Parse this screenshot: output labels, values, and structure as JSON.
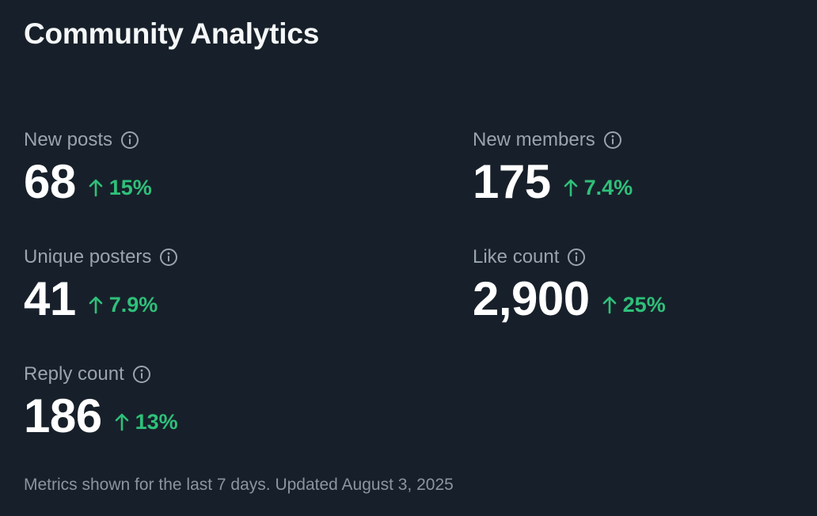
{
  "header": {
    "title": "Community Analytics"
  },
  "metrics": {
    "new_posts": {
      "label": "New posts",
      "value": "68",
      "change": "15%",
      "direction": "up"
    },
    "new_members": {
      "label": "New members",
      "value": "175",
      "change": "7.4%",
      "direction": "up"
    },
    "unique_posters": {
      "label": "Unique posters",
      "value": "41",
      "change": "7.9%",
      "direction": "up"
    },
    "like_count": {
      "label": "Like count",
      "value": "2,900",
      "change": "25%",
      "direction": "up"
    },
    "reply_count": {
      "label": "Reply count",
      "value": "186",
      "change": "13%",
      "direction": "up"
    }
  },
  "footer": {
    "note": "Metrics shown for the last 7 days. Updated August 3, 2025"
  },
  "icons": {
    "info": "info-circle-icon",
    "trend": "arrow-up-icon"
  },
  "colors": {
    "background": "#17202a",
    "positive": "#2fc07a",
    "label": "#9aa4ad",
    "value": "#ffffff"
  }
}
